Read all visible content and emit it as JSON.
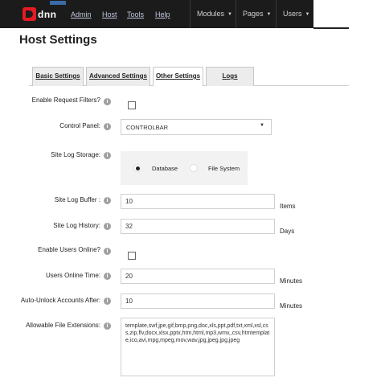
{
  "nav": {
    "logo_text": "dnn",
    "links": [
      "Admin",
      "Host",
      "Tools",
      "Help"
    ],
    "menus": [
      "Modules",
      "Pages",
      "Users"
    ]
  },
  "page": {
    "title": "Host Settings"
  },
  "tabs": [
    "Basic Settings",
    "Advanced Settings",
    "Other Settings",
    "Logs"
  ],
  "form": {
    "request_filters_label": "Enable Request Filters?",
    "control_panel_label": "Control Panel:",
    "control_panel_value": "CONTROLBAR",
    "site_log_storage_label": "Site Log Storage:",
    "storage_options": [
      "Database",
      "File System"
    ],
    "storage_selected": "Database",
    "site_log_buffer_label": "Site Log Buffer :",
    "site_log_buffer_value": "10",
    "site_log_buffer_unit": "Items",
    "site_log_history_label": "Site Log History:",
    "site_log_history_value": "32",
    "site_log_history_unit": "Days",
    "users_online_label": "Enable Users Online?",
    "users_online_time_label": "Users Online Time:",
    "users_online_time_value": "20",
    "users_online_time_unit": "Minutes",
    "auto_unlock_label": "Auto-Unlock Accounts After:",
    "auto_unlock_value": "10",
    "auto_unlock_unit": "Minutes",
    "file_ext_label": "Allowable File Extensions:",
    "file_ext_value": "template,swf,jpe,gif,bmp,png,doc,xls,ppt,pdf,txt,xml,xsl,css,zip,flv,docx,xlsx,pptx,htm,html,mp3,wmv,,csv,htmtemplate,ico,avi,mpg,mpeg,mov,wav,jpg,jpeg,jpg,jpeg"
  },
  "help_glyph": "i",
  "colors": {
    "navbar": "#1b1b1b",
    "logo_red": "#e41b23"
  }
}
